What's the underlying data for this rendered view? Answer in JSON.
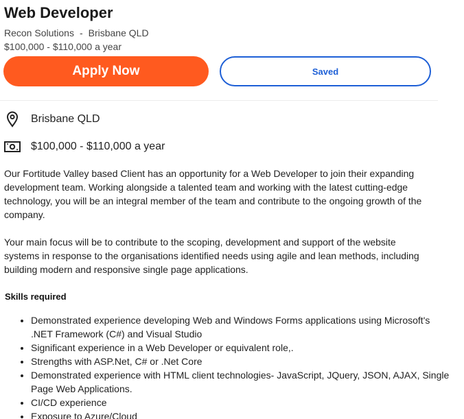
{
  "job": {
    "title": "Web Developer",
    "company": "Recon Solutions",
    "separator": "-",
    "location": "Brisbane QLD",
    "salary": "$100,000 - $110,000 a year"
  },
  "actions": {
    "apply_label": "Apply Now",
    "saved_label": "Saved",
    "apply_color": "#ff5a1f",
    "saved_color": "#1d5fd6"
  },
  "details": {
    "location": "Brisbane QLD",
    "location_icon": "map-pin-icon",
    "salary": "$100,000 - $110,000 a year",
    "salary_icon": "money-icon"
  },
  "description": {
    "paragraphs": [
      "Our Fortitude Valley based Client has an opportunity for a Web Developer to join their expanding development team. Working alongside a talented team and working with the latest cutting-edge technology, you will be an integral member of the team and contribute to the ongoing growth of the company.",
      "Your main focus will be to contribute to the scoping, development and support of the website systems in response to the organisations identified needs using agile and lean methods, including building modern and responsive single page applications."
    ]
  },
  "skills": {
    "heading": "Skills required",
    "items": [
      "Demonstrated experience developing Web and Windows Forms applications using Microsoft's .NET Framework (C#) and Visual Studio",
      "Significant experience in a Web Developer or equivalent role,.",
      "Strengths with ASP.Net, C# or .Net Core",
      "Demonstrated experience with HTML client technologies- JavaScript, JQuery, JSON, AJAX, Single Page Web Applications.",
      "CI/CD experience",
      "Exposure to Azure/Cloud"
    ]
  }
}
